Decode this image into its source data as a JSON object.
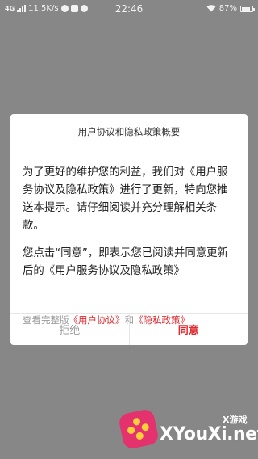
{
  "status_bar": {
    "network": "4G",
    "speed": "11.5K/s",
    "time": "22:46",
    "battery": "87%",
    "battery_level": 0.87
  },
  "dialog": {
    "title": "用户协议和隐私政策概要",
    "paragraph1": "为了更好的维护您的利益，我们对《用户服务协议及隐私政策》进行了更新，特向您推送本提示。请仔细阅读并充分理解相关条款。",
    "paragraph2": "您点击“同意”，即表示您已阅读并同意更新后的《用户服务协议及隐私政策》",
    "links_prefix": "查看完整版",
    "link_user_agreement": "《用户协议》",
    "links_and": "和",
    "link_privacy": "《隐私政策》",
    "decline_label": "拒绝",
    "agree_label": "同意"
  },
  "watermark": {
    "small": "X游戏",
    "text": "XYouXi.net"
  },
  "colors": {
    "backdrop": "#878787",
    "accent_red": "#e0282e",
    "muted_gray": "#9a9a9a"
  }
}
